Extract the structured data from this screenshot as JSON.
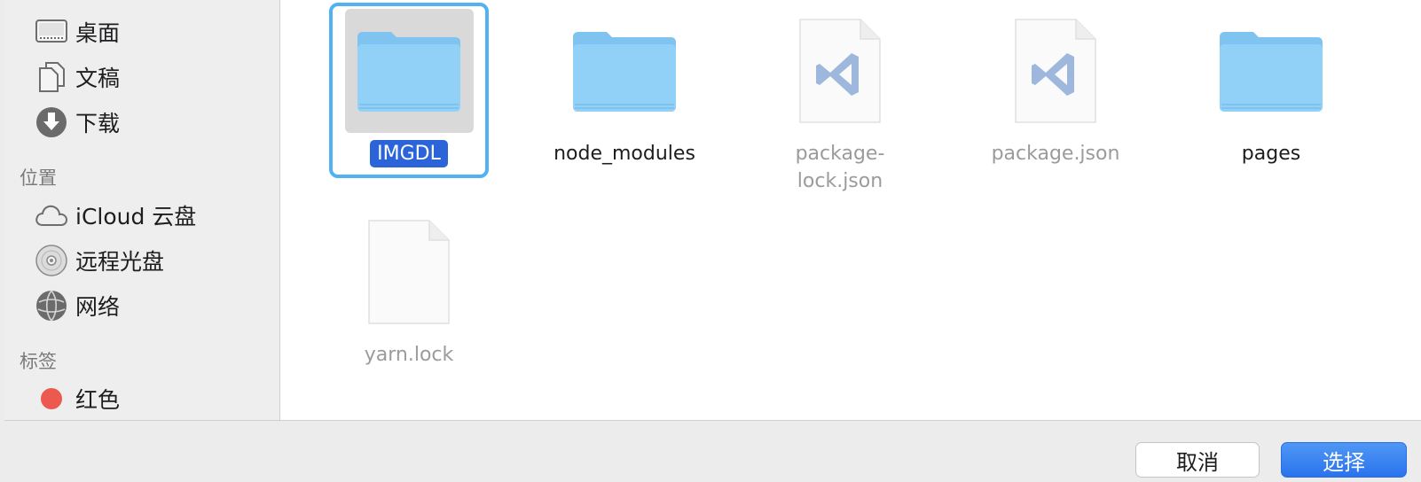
{
  "sidebar": {
    "favorites": [
      {
        "label": "桌面",
        "icon": "desktop-icon"
      },
      {
        "label": "文稿",
        "icon": "documents-icon"
      },
      {
        "label": "下载",
        "icon": "downloads-icon"
      }
    ],
    "locations_heading": "位置",
    "locations": [
      {
        "label": "iCloud 云盘",
        "icon": "icloud-icon"
      },
      {
        "label": "远程光盘",
        "icon": "remote-disc-icon"
      },
      {
        "label": "网络",
        "icon": "network-icon"
      }
    ],
    "tags_heading": "标签",
    "tags": [
      {
        "label": "红色",
        "color": "#ec5a4f",
        "icon": "red-tag-icon"
      }
    ]
  },
  "files": [
    {
      "name": "IMGDL",
      "kind": "folder",
      "selected": true
    },
    {
      "name": "node_modules",
      "kind": "folder"
    },
    {
      "name": "package-\nlock.json",
      "kind": "vscode-file",
      "disabled": true
    },
    {
      "name": "package.json",
      "kind": "vscode-file",
      "disabled": true
    },
    {
      "name": "pages",
      "kind": "folder"
    },
    {
      "name": "yarn.lock",
      "kind": "blank-file",
      "disabled": true
    }
  ],
  "footer": {
    "cancel_label": "取消",
    "choose_label": "选择"
  },
  "colors": {
    "accent": "#2a64d8",
    "selection_ring": "#52b1f4",
    "folder": "#8fcdf5"
  }
}
